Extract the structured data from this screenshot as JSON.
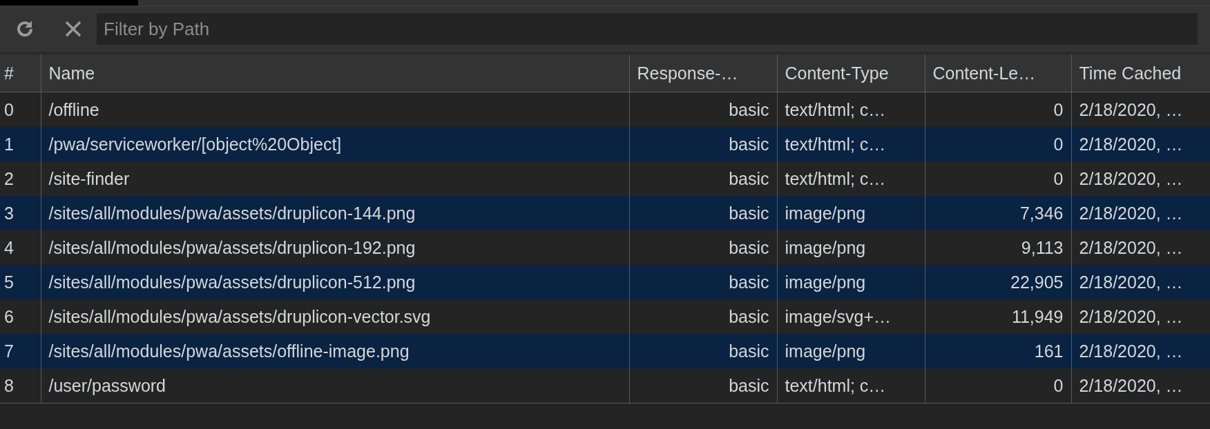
{
  "toolbar": {
    "filter": {
      "placeholder": "Filter by Path"
    }
  },
  "table": {
    "columns": [
      "#",
      "Name",
      "Response-…",
      "Content-Type",
      "Content-Le…",
      "Time Cached"
    ],
    "rows": [
      [
        "0",
        "/offline",
        "basic",
        "text/html; c…",
        "0",
        "2/18/2020, …"
      ],
      [
        "1",
        "/pwa/serviceworker/[object%20Object]",
        "basic",
        "text/html; c…",
        "0",
        "2/18/2020, …"
      ],
      [
        "2",
        "/site-finder",
        "basic",
        "text/html; c…",
        "0",
        "2/18/2020, …"
      ],
      [
        "3",
        "/sites/all/modules/pwa/assets/druplicon-144.png",
        "basic",
        "image/png",
        "7,346",
        "2/18/2020, …"
      ],
      [
        "4",
        "/sites/all/modules/pwa/assets/druplicon-192.png",
        "basic",
        "image/png",
        "9,113",
        "2/18/2020, …"
      ],
      [
        "5",
        "/sites/all/modules/pwa/assets/druplicon-512.png",
        "basic",
        "image/png",
        "22,905",
        "2/18/2020, …"
      ],
      [
        "6",
        "/sites/all/modules/pwa/assets/druplicon-vector.svg",
        "basic",
        "image/svg+…",
        "11,949",
        "2/18/2020, …"
      ],
      [
        "7",
        "/sites/all/modules/pwa/assets/offline-image.png",
        "basic",
        "image/png",
        "161",
        "2/18/2020, …"
      ],
      [
        "8",
        "/user/password",
        "basic",
        "text/html; c…",
        "0",
        "2/18/2020, …"
      ]
    ]
  }
}
